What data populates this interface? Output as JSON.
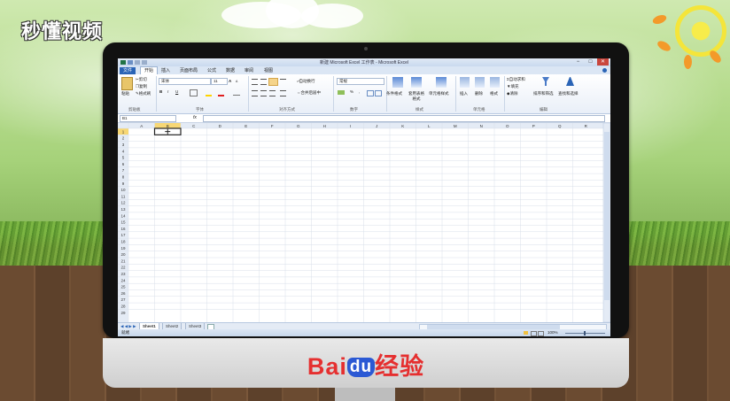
{
  "overlay": {
    "video_logo": "秒懂视频",
    "watermark_brand_latin": "Bai",
    "watermark_brand_du": "du",
    "watermark_brand_cn": "经验"
  },
  "window": {
    "title": "新建 Microsoft Excel 工作表 - Microsoft Excel",
    "minimize": "−",
    "maximize": "□",
    "close": "✕"
  },
  "tabs": [
    {
      "label": "文件",
      "kind": "file"
    },
    {
      "label": "开始",
      "kind": "active"
    },
    {
      "label": "插入"
    },
    {
      "label": "页面布局"
    },
    {
      "label": "公式"
    },
    {
      "label": "数据"
    },
    {
      "label": "审阅"
    },
    {
      "label": "视图"
    }
  ],
  "ribbon": {
    "clipboard": {
      "paste": "粘贴",
      "cut": "剪切",
      "copy": "复制",
      "format_painter": "格式刷",
      "group": "剪贴板"
    },
    "font": {
      "name": "宋体",
      "size": "11",
      "bold": "B",
      "italic": "I",
      "underline": "U",
      "grow": "A",
      "shrink": "A",
      "group": "字体"
    },
    "alignment": {
      "wrap": "自动换行",
      "merge": "合并后居中",
      "group": "对齐方式"
    },
    "number": {
      "format": "常规",
      "percent": "%",
      "comma": ",",
      "group": "数字"
    },
    "styles": {
      "conditional": "条件格式",
      "table": "套用表格格式",
      "cell": "单元格样式",
      "group": "样式"
    },
    "cells": {
      "insert": "插入",
      "delete": "删除",
      "format": "格式",
      "group": "单元格"
    },
    "editing": {
      "autosum": "自动求和",
      "fill": "填充",
      "clear": "清除",
      "sort": "排序和筛选",
      "find": "查找和选择",
      "group": "编辑"
    }
  },
  "formula_bar": {
    "name_box": "B1",
    "fx": "fx",
    "value": ""
  },
  "grid": {
    "columns": [
      "A",
      "B",
      "C",
      "D",
      "E",
      "F",
      "G",
      "H",
      "I",
      "J",
      "K",
      "L",
      "M",
      "N",
      "O",
      "P",
      "Q",
      "R"
    ],
    "rows": [
      "1",
      "2",
      "3",
      "4",
      "5",
      "6",
      "7",
      "8",
      "9",
      "10",
      "11",
      "12",
      "13",
      "14",
      "15",
      "16",
      "17",
      "18",
      "19",
      "20",
      "21",
      "22",
      "23",
      "24",
      "25",
      "26",
      "27",
      "28",
      "29"
    ],
    "selected_column": "B",
    "selected_row": "1"
  },
  "sheets": [
    "Sheet1",
    "Sheet2",
    "Sheet3"
  ],
  "status": {
    "mode": "就绪",
    "zoom": "100%"
  },
  "colors": {
    "accent": "#2a64b6",
    "selection": "#f7d775",
    "excel_green": "#217346"
  }
}
